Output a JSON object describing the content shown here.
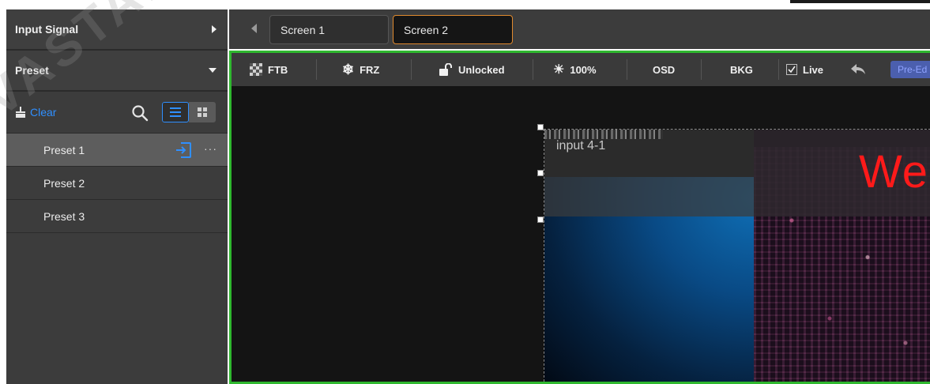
{
  "left_panel": {
    "input_signal_label": "Input Signal",
    "preset_label": "Preset",
    "clear_label": "Clear",
    "presets": [
      {
        "label": "Preset 1",
        "selected": true
      },
      {
        "label": "Preset 2",
        "selected": false
      },
      {
        "label": "Preset 3",
        "selected": false
      }
    ],
    "more_label": "···"
  },
  "screens": {
    "tabs": [
      {
        "label": "Screen 1",
        "active": false
      },
      {
        "label": "Screen 2",
        "active": true
      }
    ]
  },
  "toolbar": {
    "ftb_label": "FTB",
    "frz_label": "FRZ",
    "lock_label": "Unlocked",
    "brightness_label": "100%",
    "osd_label": "OSD",
    "bkg_label": "BKG",
    "live_label": "Live",
    "live_checked": true,
    "preedit_label": "Pre-Ed"
  },
  "canvas": {
    "layer_title": "input 4-1",
    "layer_text": "We"
  },
  "watermark": "NOVASTAR",
  "colors": {
    "accent_blue": "#2f8fff",
    "active_tab_border": "#e08a2e",
    "frame_green": "#2fb82f",
    "layer_text_red": "#ff1a1a"
  }
}
